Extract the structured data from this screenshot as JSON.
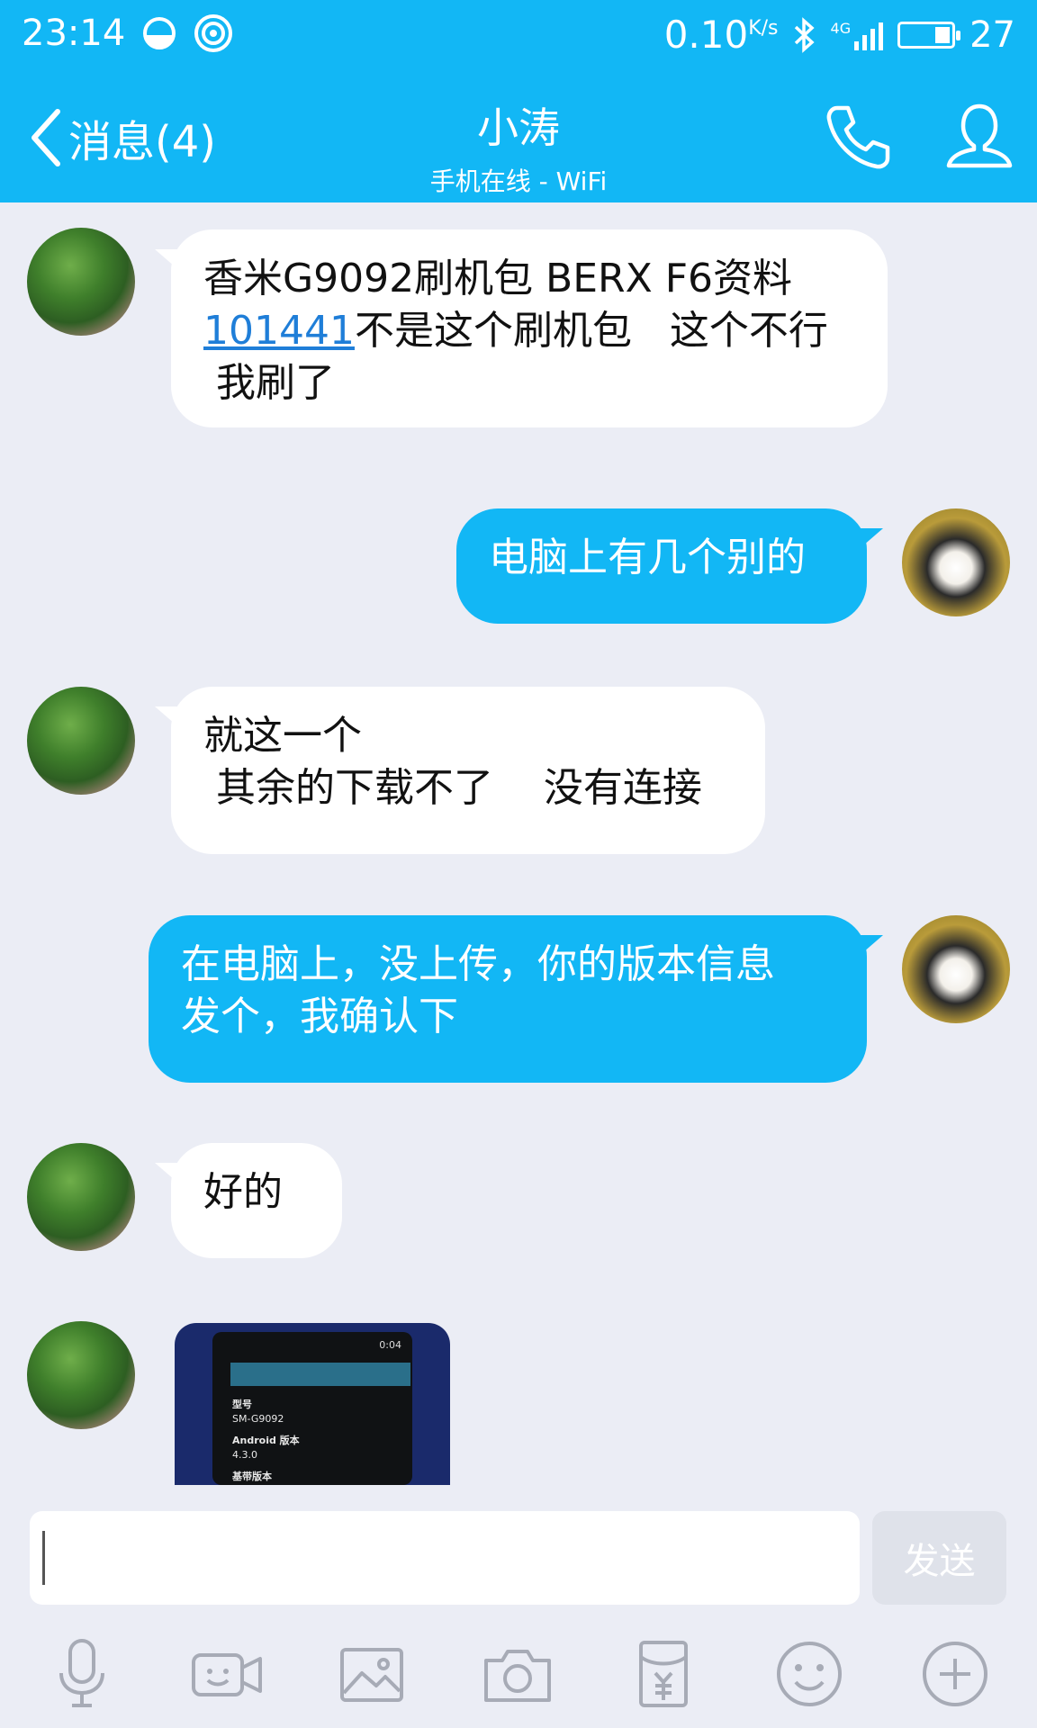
{
  "status_bar": {
    "time": "23:14",
    "net_speed": "0.10",
    "net_speed_unit": "K/s",
    "network_type": "4G",
    "battery": "27",
    "battery_level": 0.27
  },
  "header": {
    "back_label": "消息(4)",
    "title": "小涛",
    "subtitle": "手机在线 - WiFi"
  },
  "messages": [
    {
      "side": "in",
      "lines": [
        "香米G9092刷机包 BERX F6资料"
      ],
      "link": "101441",
      "after_link": "不是这个刷机包   这个不行",
      "tail": " 我刷了"
    },
    {
      "side": "out",
      "text": "电脑上有几个别的"
    },
    {
      "side": "in",
      "line1": "就这一个",
      "line2": " 其余的下载不了    没有连接"
    },
    {
      "side": "out",
      "line1": "在电脑上，没上传，你的版本信息",
      "line2": "发个，我确认下"
    },
    {
      "side": "in",
      "text": "好的"
    },
    {
      "side": "in",
      "type": "image",
      "screenshot": {
        "time": "0:04",
        "row1": "型号",
        "row2": "SM-G9092",
        "row3": "Android 版本",
        "row4": "4.3.0",
        "row5": "基带版本"
      }
    }
  ],
  "input": {
    "value": "",
    "send_label": "发送"
  },
  "toolbar": [
    {
      "icon": "microphone-icon"
    },
    {
      "icon": "video-call-icon"
    },
    {
      "icon": "image-icon"
    },
    {
      "icon": "camera-icon"
    },
    {
      "icon": "red-packet-icon"
    },
    {
      "icon": "emoji-icon"
    },
    {
      "icon": "plus-icon"
    }
  ],
  "colors": {
    "brand": "#12b7f5",
    "background": "#ebedf5",
    "link": "#1f7ed8"
  }
}
